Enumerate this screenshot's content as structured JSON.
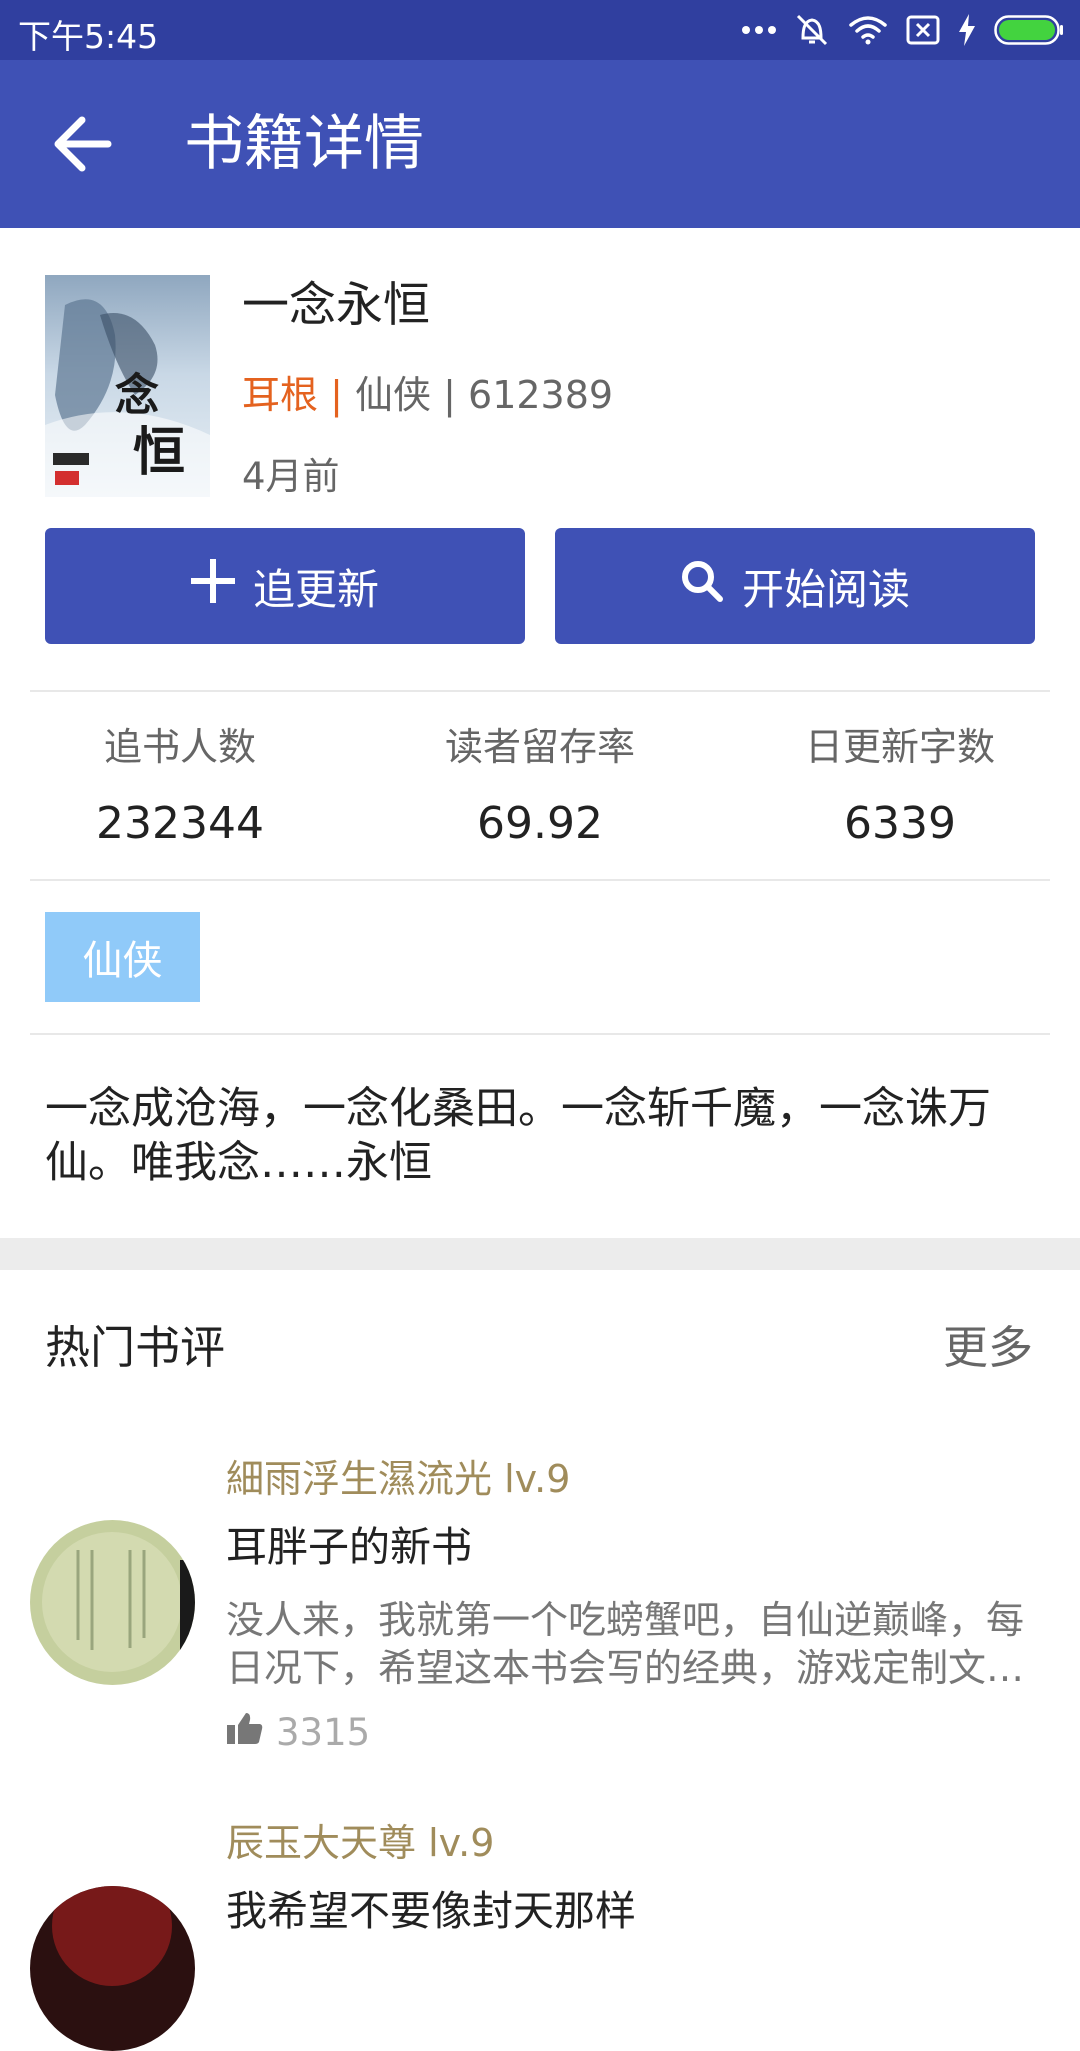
{
  "status_bar": {
    "time": "下午5:45",
    "icons": [
      "more-dots-icon",
      "vibrate-icon",
      "wifi-icon",
      "no-sim-icon",
      "charging-icon",
      "battery-icon"
    ]
  },
  "app_bar": {
    "back_icon": "arrow-left-icon",
    "title": "书籍详情"
  },
  "book": {
    "title": "一念永恒",
    "author": "耳根",
    "divider": "|",
    "category": "仙侠",
    "word_count": "612389",
    "updated": "4月前"
  },
  "actions": {
    "follow_label": "追更新",
    "follow_icon": "plus-icon",
    "read_label": "开始阅读",
    "read_icon": "search-icon"
  },
  "stats": [
    {
      "label": "追书人数",
      "value": "232344"
    },
    {
      "label": "读者留存率",
      "value": "69.92"
    },
    {
      "label": "日更新字数",
      "value": "6339"
    }
  ],
  "tags": [
    "仙侠"
  ],
  "description": "一念成沧海，一念化桑田。一念斩千魔，一念诛万仙。唯我念……永恒",
  "reviews_section": {
    "title": "热门书评",
    "more_label": "更多",
    "items": [
      {
        "user": "細雨浮生濕流光 lv.9",
        "title": "耳胖子的新书",
        "body": "没人来，我就第一个吃螃蟹吧，自仙逆巅峰，每日况下，希望这本书会写的经典，游戏定制文…",
        "likes": "3315"
      },
      {
        "user": "辰玉大天尊 lv.9",
        "title": "我希望不要像封天那样"
      }
    ]
  },
  "colors": {
    "status_bar": "#303f9f",
    "primary": "#3f51b5",
    "author": "#e4621f",
    "tag": "#90caf9",
    "username": "#a08c5b"
  }
}
